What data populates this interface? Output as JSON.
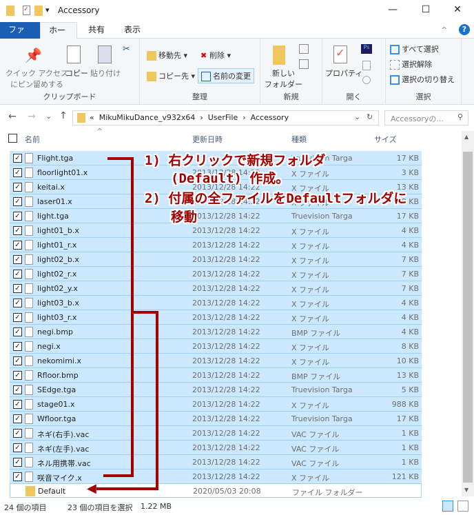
{
  "window": {
    "title": "Accessory",
    "minimize": "—",
    "maximize": "☐",
    "close": "✕"
  },
  "tabs": [
    "ファイル",
    "ホーム",
    "共有",
    "表示"
  ],
  "ribbon": {
    "clipboard": {
      "label": "クリップボード",
      "pin": "クイック アクセス\nにピン留めする",
      "copy": "コピー",
      "paste": "貼り付け"
    },
    "organize": {
      "label": "整理",
      "move": "移動先 ▾",
      "copyto": "コピー先 ▾",
      "delete": "削除 ▾",
      "rename": "名前の変更"
    },
    "new": {
      "label": "新規",
      "folder": "新しい\nフォルダー"
    },
    "open": {
      "label": "開く",
      "properties": "プロパティ"
    },
    "select": {
      "label": "選択",
      "all": "すべて選択",
      "none": "選択解除",
      "invert": "選択の切り替え"
    }
  },
  "address": {
    "path": [
      "«",
      "MikuMikuDance_v932x64",
      "›",
      "UserFile",
      "›",
      "Accessory"
    ],
    "search_placeholder": "Accessoryの..."
  },
  "columns": {
    "name": "名前",
    "date": "更新日時",
    "type": "種類",
    "size": "サイズ"
  },
  "files": [
    [
      "Flight.tga",
      "",
      "Truevision Targa",
      "17 KB"
    ],
    [
      "floorlight01.x",
      "2013/12/28 14:22",
      "X ファイル",
      "3 KB"
    ],
    [
      "keitai.x",
      "2013/12/28 14:22",
      "X ファイル",
      "13 KB"
    ],
    [
      "laser01.x",
      "2013/12/28 14:22",
      "X ファイル",
      "8 KB"
    ],
    [
      "light.tga",
      "2013/12/28 14:22",
      "Truevision Targa",
      "17 KB"
    ],
    [
      "light01_b.x",
      "2013/12/28 14:22",
      "X ファイル",
      "4 KB"
    ],
    [
      "light01_r.x",
      "2013/12/28 14:22",
      "X ファイル",
      "4 KB"
    ],
    [
      "light02_b.x",
      "2013/12/28 14:22",
      "X ファイル",
      "7 KB"
    ],
    [
      "light02_r.x",
      "2013/12/28 14:22",
      "X ファイル",
      "7 KB"
    ],
    [
      "light02_y.x",
      "2013/12/28 14:22",
      "X ファイル",
      "7 KB"
    ],
    [
      "light03_b.x",
      "2013/12/28 14:22",
      "X ファイル",
      "4 KB"
    ],
    [
      "light03_r.x",
      "2013/12/28 14:22",
      "X ファイル",
      "4 KB"
    ],
    [
      "negi.bmp",
      "2013/12/28 14:22",
      "BMP ファイル",
      "4 KB"
    ],
    [
      "negi.x",
      "2013/12/28 14:22",
      "X ファイル",
      "8 KB"
    ],
    [
      "nekomimi.x",
      "2013/12/28 14:22",
      "X ファイル",
      "10 KB"
    ],
    [
      "Rfloor.bmp",
      "2013/12/28 14:22",
      "BMP ファイル",
      "13 KB"
    ],
    [
      "SEdge.tga",
      "2013/12/28 14:22",
      "Truevision Targa",
      "5 KB"
    ],
    [
      "stage01.x",
      "2013/12/28 14:22",
      "X ファイル",
      "988 KB"
    ],
    [
      "Wfloor.tga",
      "2013/12/28 14:22",
      "Truevision Targa",
      "17 KB"
    ],
    [
      "ネギ(右手).vac",
      "2013/12/28 14:22",
      "VAC ファイル",
      "1 KB"
    ],
    [
      "ネギ(左手).vac",
      "2013/12/28 14:22",
      "VAC ファイル",
      "1 KB"
    ],
    [
      "ネル用携帯.vac",
      "2013/12/28 14:22",
      "VAC ファイル",
      "1 KB"
    ],
    [
      "咲音マイク.x",
      "2013/12/28 14:22",
      "X ファイル",
      "121 KB"
    ]
  ],
  "folder": {
    "name": "Default",
    "date": "2020/05/03 20:08",
    "type": "ファイル フォルダー"
  },
  "status": {
    "count": "24 個の項目",
    "selected": "23 個の項目を選択",
    "size": "1.22 MB"
  },
  "annotation": {
    "line1": "1) 右クリックで新規フォルダ",
    "line2": "(Default) 作成。",
    "line3": "2) 付属の全ファイルをDefaultフォルダに",
    "line4": "移動"
  }
}
